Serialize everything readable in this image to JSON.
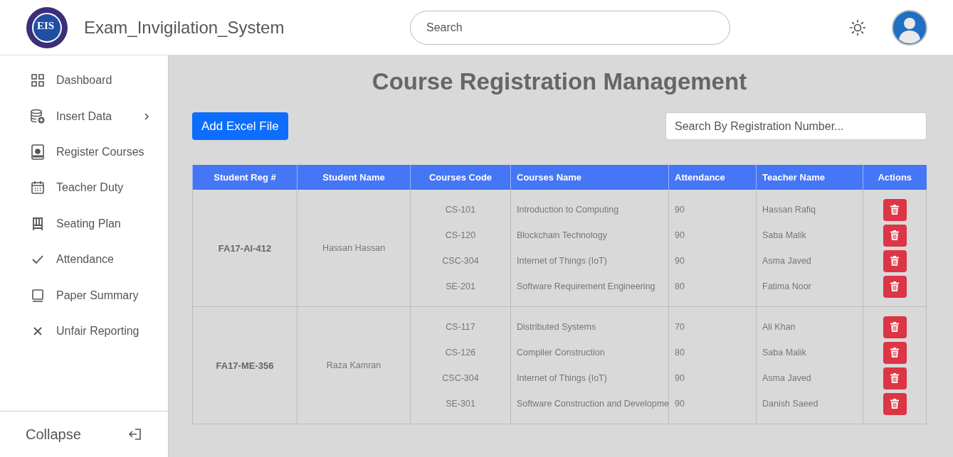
{
  "header": {
    "logo_initials": "EIS",
    "title": "Exam_Invigilation_System",
    "search": {
      "placeholder": "Search"
    }
  },
  "sidebar": {
    "items": [
      {
        "label": "Dashboard",
        "expandable": false
      },
      {
        "label": "Insert Data",
        "expandable": true
      },
      {
        "label": "Register Courses",
        "expandable": false
      },
      {
        "label": "Teacher Duty",
        "expandable": false
      },
      {
        "label": "Seating Plan",
        "expandable": false
      },
      {
        "label": "Attendance",
        "expandable": false
      },
      {
        "label": "Paper Summary",
        "expandable": false
      },
      {
        "label": "Unfair Reporting",
        "expandable": false
      }
    ],
    "collapse_label": "Collapse"
  },
  "page_title": "Course Registration Management",
  "add_button": "Add Excel File",
  "reg_search": {
    "placeholder": "Search By Registration Number..."
  },
  "table": {
    "columns": [
      "Student Reg #",
      "Student Name",
      "Courses Code",
      "Courses Name",
      "Attendance",
      "Teacher Name",
      "Actions"
    ],
    "rows": [
      {
        "reg": "FA17-AI-412",
        "name": "Hassan Hassan",
        "courses": [
          {
            "code": "CS-101",
            "name": "Introduction to Computing",
            "attendance": "90",
            "teacher": "Hassan Rafiq"
          },
          {
            "code": "CS-120",
            "name": "Blockchain Technology",
            "attendance": "90",
            "teacher": "Saba Malik"
          },
          {
            "code": "CSC-304",
            "name": "Internet of Things (IoT)",
            "attendance": "90",
            "teacher": "Asma Javed"
          },
          {
            "code": "SE-201",
            "name": "Software Requirement Engineering",
            "attendance": "80",
            "teacher": "Fatima Noor"
          }
        ]
      },
      {
        "reg": "FA17-ME-356",
        "name": "Raza Kamran",
        "courses": [
          {
            "code": "CS-117",
            "name": "Distributed Systems",
            "attendance": "70",
            "teacher": "Ali Khan"
          },
          {
            "code": "CS-126",
            "name": "Compiler Construction",
            "attendance": "80",
            "teacher": "Saba Malik"
          },
          {
            "code": "CSC-304",
            "name": "Internet of Things (IoT)",
            "attendance": "90",
            "teacher": "Asma Javed"
          },
          {
            "code": "SE-301",
            "name": "Software Construction and Developme",
            "attendance": "90",
            "teacher": "Danish Saeed"
          }
        ]
      }
    ]
  }
}
